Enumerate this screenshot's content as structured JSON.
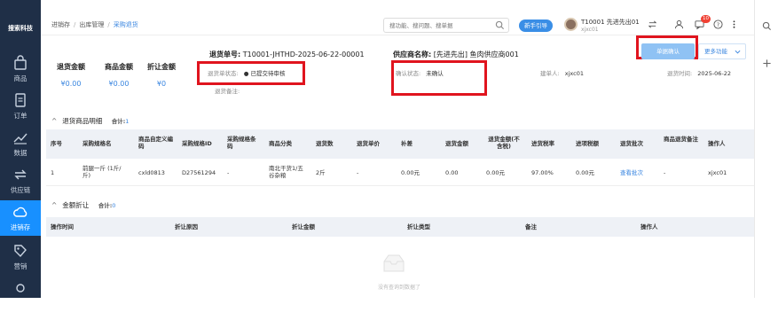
{
  "sidebar": {
    "logo": "搜索科技",
    "items": [
      {
        "label": "商品",
        "icon": "bag-icon"
      },
      {
        "label": "订单",
        "icon": "document-icon"
      },
      {
        "label": "数据",
        "icon": "chart-line-icon"
      },
      {
        "label": "供应链",
        "icon": "exchange-icon"
      },
      {
        "label": "进销存",
        "icon": "cloud-icon"
      },
      {
        "label": "营销",
        "icon": "tag-icon"
      }
    ]
  },
  "header": {
    "breadcrumb": [
      "进销存",
      "出库管理",
      "采购退货"
    ],
    "search_placeholder": "搜功能、搜问题、搜单据",
    "guide_label": "新手引导",
    "user_name": "T10001 先进先出01",
    "user_sub": "xjxc01",
    "badge": "10"
  },
  "summary": [
    {
      "label": "退货金额",
      "value": "¥0.00"
    },
    {
      "label": "商品金额",
      "value": "¥0.00"
    },
    {
      "label": "折让金额",
      "value": "¥0"
    }
  ],
  "order": {
    "no_label": "退货单号:",
    "no": "T10001-JHTHD-2025-06-22-00001",
    "supplier_label": "供应商名称:",
    "supplier": "[先进先出] 鱼肉供应商001",
    "status_label": "退货单状态:",
    "status": "已提交待审核",
    "remark_label": "退货备注:",
    "confirm_label": "确认状态:",
    "confirm": "未确认",
    "creator_label": "建单人:",
    "creator": "xjxc01",
    "time_label": "退货时间:",
    "time": "2025-06-22"
  },
  "actions": {
    "confirm_btn": "单据确认",
    "more_btn": "更多功能"
  },
  "goods_section": {
    "title": "退货商品明细",
    "count_label": "合计:",
    "count": "1",
    "columns": [
      "序号",
      "采购规格名",
      "商品自定义编码",
      "采购规格ID",
      "采购规格条码",
      "商品分类",
      "退货数",
      "退货单价",
      "补差",
      "退货金额",
      "退货金额(不含税)",
      "进货税率",
      "进项税额",
      "退货批次",
      "商品退货备注",
      "操作人"
    ],
    "rows": [
      [
        "1",
        "前腿一斤 (1斤/斤)",
        "cxld0813",
        "D27561294",
        "-",
        "南北干货1/五谷杂粮",
        "2斤",
        "-",
        "0.00元",
        "0.00",
        "0.00元",
        "97.00%",
        "0.00元",
        "查看批次",
        "-",
        "xjxc01"
      ]
    ]
  },
  "discount_section": {
    "title": "金额折让",
    "count_label": "合计:",
    "count": "0",
    "columns": [
      "操作时间",
      "折让原因",
      "折让金额",
      "折让类型",
      "备注",
      "操作人"
    ],
    "empty_text": "没有查询到数据了"
  }
}
